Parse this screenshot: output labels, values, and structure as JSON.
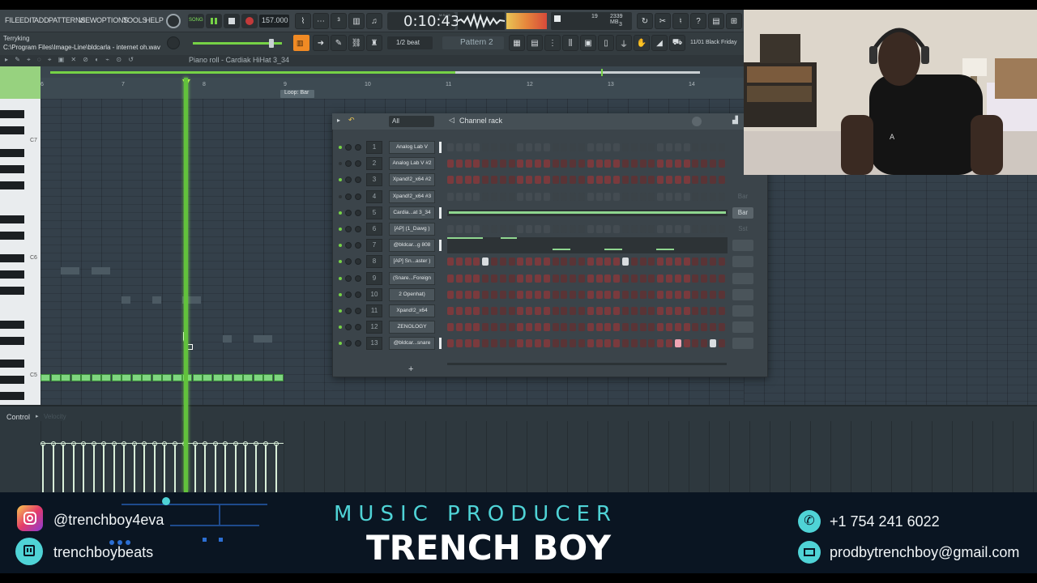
{
  "menu": [
    "FILE",
    "EDIT",
    "ADD",
    "PATTERNS",
    "VIEW",
    "OPTIONS",
    "TOOLS",
    "HELP"
  ],
  "transport": {
    "mode": "SONG",
    "tempo": "157.000",
    "time": "0:10:43",
    "time_unit": "M:S:CS",
    "cpu": "19",
    "memory": "2339 MB",
    "voices": "3"
  },
  "project": {
    "user": "Terryking",
    "hint": "C:\\Program Files\\Image-Line\\bldcarla - internet oh.wav",
    "snap": "1/2 beat",
    "pattern": "Pattern 2",
    "news": "11/01  Black Friday"
  },
  "pianoroll": {
    "title": "Piano roll - Cardiak HiHat 3_34",
    "bars": [
      "6",
      "7",
      "8",
      "9",
      "10",
      "11",
      "12",
      "13",
      "14"
    ],
    "loop_label": "Loop: Bar",
    "key_labels": [
      "C7",
      "C6",
      "C5"
    ],
    "control_label": "Control",
    "control_param": "Velocity"
  },
  "channelrack": {
    "title": "Channel rack",
    "filter": "All",
    "add_symbol": "+",
    "channels": [
      {
        "num": "1",
        "name": "Analog Lab V"
      },
      {
        "num": "2",
        "name": "Analog Lab V #2"
      },
      {
        "num": "3",
        "name": "Xpand!2_x64 #2"
      },
      {
        "num": "4",
        "name": "Xpand!2_x64 #3"
      },
      {
        "num": "5",
        "name": "Cardia...at 3_34"
      },
      {
        "num": "6",
        "name": "[AP] (1_Dawg )"
      },
      {
        "num": "7",
        "name": "@bldcar...g 808"
      },
      {
        "num": "8",
        "name": "[AP] Sn...aster )"
      },
      {
        "num": "9",
        "name": "(Snare...Foreign"
      },
      {
        "num": "10",
        "name": "2 Openhat)"
      },
      {
        "num": "11",
        "name": "Xpand!2_x64"
      },
      {
        "num": "12",
        "name": "ZENOLOGY"
      },
      {
        "num": "13",
        "name": "@bldcar...snare"
      }
    ],
    "side_labels": {
      "row4": "Bar",
      "row5": "Bar",
      "row6": "Sst"
    }
  },
  "footer": {
    "instagram": "@trenchboy4eva",
    "twitch": "trenchboybeats",
    "role": "MUSIC PRODUCER",
    "name": "TRENCH BOY",
    "phone": "+1 754 241 6022",
    "email": "prodbytrenchboy@gmail.com",
    "colors": {
      "accent": "#4fd3d6",
      "name": "#ffffff",
      "bg": "#0a1522"
    }
  },
  "icons": [
    "instagram-icon",
    "twitch-icon",
    "phone-icon",
    "mail-icon"
  ]
}
